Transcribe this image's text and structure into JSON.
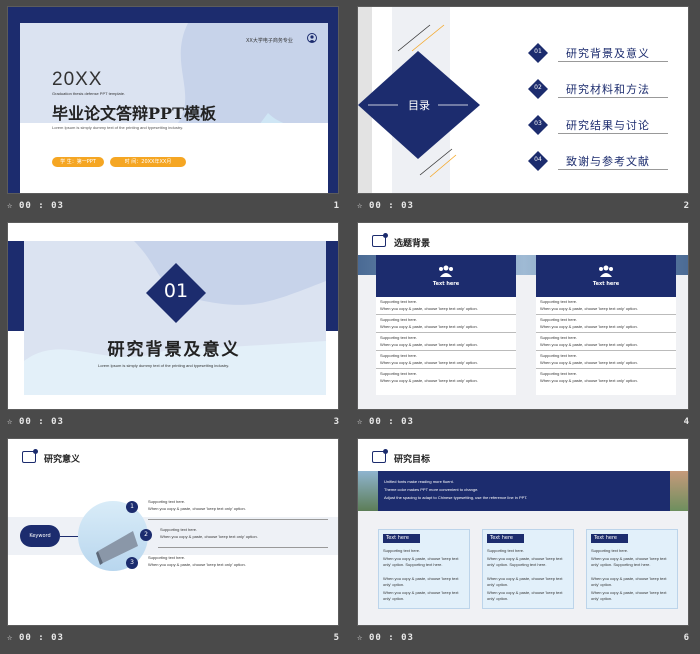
{
  "slides": [
    {
      "number": "1",
      "time": "00 : 03",
      "school": "XX大学电子商务专业",
      "year": "20XX",
      "subtitle_en": "Graduation  thesis  defense  PPT  template.",
      "title": "毕业论文答辩PPT模板",
      "lorem": "Lorem Ipsum is simply dummy text of the printing and typesetting  industry.",
      "student": "学 生：第一PPT",
      "date": "时  间：20XX年XX月"
    },
    {
      "number": "2",
      "time": "00 : 03",
      "toc_title": "目录",
      "items": [
        {
          "num": "01",
          "label": "研究背景及意义"
        },
        {
          "num": "02",
          "label": "研究材料和方法"
        },
        {
          "num": "03",
          "label": "研究结果与讨论"
        },
        {
          "num": "04",
          "label": "致谢与参考文献"
        }
      ]
    },
    {
      "number": "3",
      "time": "00 : 03",
      "section_num": "01",
      "section_title": "研究背景及意义",
      "lorem": "Lorem Ipsum is simply dummy text of the printing and typesetting  industry."
    },
    {
      "number": "4",
      "time": "00 : 03",
      "heading": "选题背景",
      "card_title": "Text here",
      "lines": [
        "Supporting text here.",
        "When you copy & paste, choose 'keep text only' option."
      ]
    },
    {
      "number": "5",
      "time": "00 : 03",
      "heading": "研究意义",
      "keyword": "Keyword",
      "points": [
        {
          "num": "1",
          "a": "Supporting text here.",
          "b": "When you copy & paste, choose 'keep text only' option."
        },
        {
          "num": "2",
          "a": "Supporting text here.",
          "b": "When you copy & paste, choose 'keep text only' option."
        },
        {
          "num": "3",
          "a": "Supporting text here.",
          "b": "When you copy & paste, choose 'keep text only' option."
        }
      ]
    },
    {
      "number": "6",
      "time": "00 : 03",
      "heading": "研究目标",
      "banner": [
        "Unified  fonts make  reading  more fluent.",
        "Theme  color makes  PPT more convenient  to change.",
        "Adjust  the spacing  to adapt  to Chinese  typesetting,  use the reference  line  in PPT."
      ],
      "box_title": "Text here",
      "box_lines": [
        "Supporting text here.",
        "When you copy & paste, choose 'keep text only' option. Supporting text here.",
        "When you copy & paste, choose 'keep text only' option.",
        "When you copy & paste, choose 'keep text only' option."
      ]
    }
  ],
  "colors": {
    "navy": "#1c2c6e",
    "accent": "#f5a623",
    "light": "#dfe6f3"
  }
}
